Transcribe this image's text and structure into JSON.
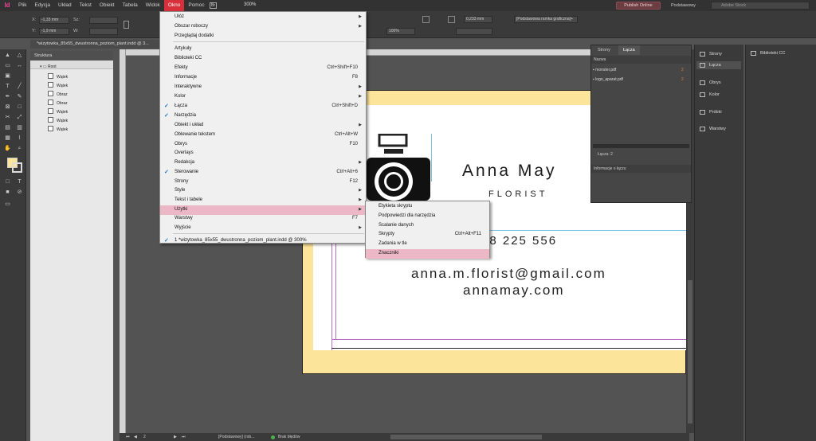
{
  "menubar": {
    "logo": "Id",
    "items": [
      "Plik",
      "Edycja",
      "Układ",
      "Tekst",
      "Obiekt",
      "Tabela",
      "Widok",
      "Okno",
      "Pomoc"
    ],
    "zoom": "300%",
    "publish": "Publish Online",
    "workspace": "Podstawowy",
    "search_placeholder": "Adobe Stock"
  },
  "control": {
    "x_label": "X:",
    "x_value": "-1,33 mm",
    "y_label": "Y:",
    "y_value": "-1,9 mm",
    "w_label": "Sz:",
    "h_label": "W:",
    "stroke_value": "0,233 mm",
    "opacity": "100%",
    "frame_style": "[Podstawowa ramka graficzna]+"
  },
  "document": {
    "tab_title": "*wizytowka_85x55_dwustronna_poziom_plant.indd @ 3..."
  },
  "structure": {
    "title": "Struktura",
    "root": "Root",
    "items": [
      "Wątek",
      "Wątek",
      "Obraz",
      "Obraz",
      "Wątek",
      "Wątek",
      "Wątek"
    ]
  },
  "card": {
    "name": "Anna May",
    "role": "FLORIST",
    "phone": "58 225 556",
    "email": "anna.m.florist@gmail.com",
    "web": "annamay.com"
  },
  "status": {
    "page": "2",
    "style": "[Podstawowy] (rob...",
    "preflight": "Brak błędów"
  },
  "links_panel": {
    "tabs": [
      "Strony",
      "Łącza"
    ],
    "column": "Nazwa",
    "files": [
      {
        "name": "monster.pdf",
        "page": "2"
      },
      {
        "name": "logo_aparat.pdf",
        "page": "2"
      }
    ],
    "count": "Łącza: 2",
    "info": "Informacje o łączu"
  },
  "dock1": {
    "items": [
      "Strony",
      "Łącza",
      "Obrys",
      "Kolor",
      "Próbki",
      "Warstwy"
    ]
  },
  "dock2": {
    "items": [
      "Biblioteki CC"
    ]
  },
  "okno_menu": {
    "items": [
      {
        "label": "Ułóż",
        "shortcut": "",
        "submenu": true,
        "checked": false
      },
      {
        "label": "Obszar roboczy",
        "shortcut": "",
        "submenu": true,
        "checked": false
      },
      {
        "label": "Przeglądaj dodatki",
        "shortcut": "",
        "submenu": false,
        "checked": false
      },
      {
        "label": "Artykuły",
        "shortcut": "",
        "submenu": false,
        "checked": false
      },
      {
        "label": "Biblioteki CC",
        "shortcut": "",
        "submenu": false,
        "checked": false
      },
      {
        "label": "Efekty",
        "shortcut": "Ctrl+Shift+F10",
        "submenu": false,
        "checked": false
      },
      {
        "label": "Informacje",
        "shortcut": "F8",
        "submenu": false,
        "checked": false
      },
      {
        "label": "Interaktywne",
        "shortcut": "",
        "submenu": true,
        "checked": false
      },
      {
        "label": "Kolor",
        "shortcut": "",
        "submenu": true,
        "checked": false
      },
      {
        "label": "Łącza",
        "shortcut": "Ctrl+Shift+D",
        "submenu": false,
        "checked": true
      },
      {
        "label": "Narzędzia",
        "shortcut": "",
        "submenu": false,
        "checked": true
      },
      {
        "label": "Obiekt i układ",
        "shortcut": "",
        "submenu": true,
        "checked": false
      },
      {
        "label": "Oblewanie tekstem",
        "shortcut": "Ctrl+Alt+W",
        "submenu": false,
        "checked": false
      },
      {
        "label": "Obrys",
        "shortcut": "F10",
        "submenu": false,
        "checked": false
      },
      {
        "label": "Overlays",
        "shortcut": "",
        "submenu": false,
        "checked": false
      },
      {
        "label": "Redakcja",
        "shortcut": "",
        "submenu": true,
        "checked": false
      },
      {
        "label": "Sterowanie",
        "shortcut": "Ctrl+Alt+6",
        "submenu": false,
        "checked": true
      },
      {
        "label": "Strony",
        "shortcut": "F12",
        "submenu": false,
        "checked": false
      },
      {
        "label": "Style",
        "shortcut": "",
        "submenu": true,
        "checked": false
      },
      {
        "label": "Tekst i tabele",
        "shortcut": "",
        "submenu": true,
        "checked": false
      },
      {
        "label": "Użytki",
        "shortcut": "",
        "submenu": true,
        "checked": false
      },
      {
        "label": "Warstwy",
        "shortcut": "F7",
        "submenu": false,
        "checked": false
      },
      {
        "label": "Wyjście",
        "shortcut": "",
        "submenu": true,
        "checked": false
      },
      {
        "label": "1 *wizytowka_85x55_dwustronna_poziom_plant.indd @ 300%",
        "shortcut": "",
        "submenu": false,
        "checked": true
      }
    ]
  },
  "sub_menu": {
    "items": [
      {
        "label": "Etykieta skryptu",
        "shortcut": ""
      },
      {
        "label": "Podpowiedzi dla narzędzia",
        "shortcut": ""
      },
      {
        "label": "Scalanie danych",
        "shortcut": ""
      },
      {
        "label": "Skrypty",
        "shortcut": "Ctrl+Alt+F11"
      },
      {
        "label": "Zadania w tle",
        "shortcut": ""
      },
      {
        "label": "Znaczniki",
        "shortcut": ""
      }
    ]
  },
  "colors": {
    "menu_highlight": "#ecb8c8",
    "card_yellow": "#fde49b",
    "active_menu": "#d8303a",
    "check": "#1a6fc9"
  }
}
